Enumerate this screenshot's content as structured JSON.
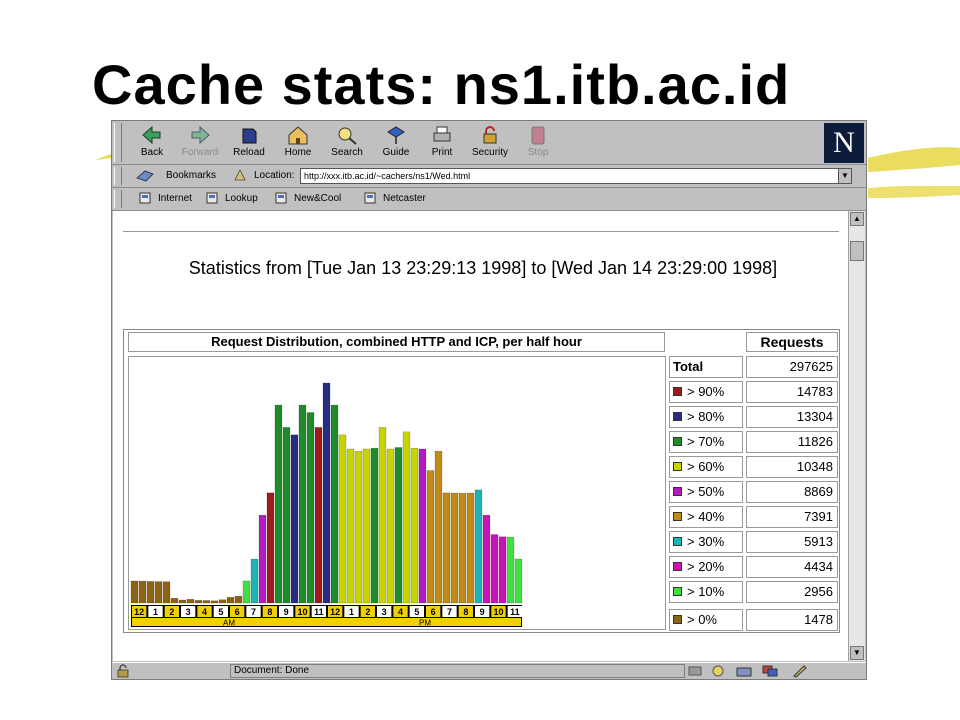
{
  "slide": {
    "title": "Cache stats: ns1.itb.ac.id"
  },
  "browser": {
    "nav_buttons": [
      {
        "label": "Back",
        "icon": "back-arrow-icon",
        "disabled": false
      },
      {
        "label": "Forward",
        "icon": "forward-arrow-icon",
        "disabled": true
      },
      {
        "label": "Reload",
        "icon": "reload-icon",
        "disabled": false
      },
      {
        "label": "Home",
        "icon": "home-icon",
        "disabled": false
      },
      {
        "label": "Search",
        "icon": "search-icon",
        "disabled": false
      },
      {
        "label": "Guide",
        "icon": "guide-icon",
        "disabled": false
      },
      {
        "label": "Print",
        "icon": "print-icon",
        "disabled": false
      },
      {
        "label": "Security",
        "icon": "lock-icon",
        "disabled": false
      },
      {
        "label": "Stop",
        "icon": "stop-icon",
        "disabled": true
      }
    ],
    "bookmarks_label": "Bookmarks",
    "location_label": "Location:",
    "url": "http://xxx.itb.ac.id/~cachers/ns1/Wed.html",
    "personal": [
      "Internet",
      "Lookup",
      "New&Cool",
      "Netcaster"
    ],
    "status": "Document: Done"
  },
  "page": {
    "heading": "Statistics from [Tue Jan 13 23:29:13 1998] to [Wed Jan 14 23:29:00 1998]",
    "chart_title": "Request Distribution, combined HTTP and ICP, per half hour",
    "requests_header": "Requests",
    "total_label": "Total",
    "total_value": "297625",
    "legend": [
      {
        "label": "> 90%",
        "value": "14783",
        "color": "#9c1c1c"
      },
      {
        "label": "> 80%",
        "value": "13304",
        "color": "#282c84"
      },
      {
        "label": "> 70%",
        "value": "11826",
        "color": "#1e8c28"
      },
      {
        "label": "> 60%",
        "value": "10348",
        "color": "#c8d400"
      },
      {
        "label": "> 50%",
        "value": "8869",
        "color": "#b01cc0"
      },
      {
        "label": "> 40%",
        "value": "7391",
        "color": "#c08c14"
      },
      {
        "label": "> 30%",
        "value": "5913",
        "color": "#1cb4b4"
      },
      {
        "label": "> 20%",
        "value": "4434",
        "color": "#c814b4"
      },
      {
        "label": "> 10%",
        "value": "2956",
        "color": "#40e040"
      },
      {
        "label": "> 0%",
        "value": "1478",
        "color": "#8c6414"
      }
    ]
  },
  "chart_data": {
    "type": "bar",
    "title": "Request Distribution, combined HTTP and ICP, per half hour",
    "hour_labels": [
      "12",
      "1",
      "2",
      "3",
      "4",
      "5",
      "6",
      "7",
      "8",
      "9",
      "10",
      "11",
      "12",
      "1",
      "2",
      "3",
      "4",
      "5",
      "6",
      "7",
      "8",
      "9",
      "10",
      "11"
    ],
    "period_labels": [
      "AM",
      "PM"
    ],
    "max_value": 14783,
    "values": [
      1480,
      1470,
      1450,
      1440,
      1430,
      320,
      200,
      250,
      180,
      170,
      150,
      220,
      380,
      460,
      1480,
      2950,
      5900,
      7400,
      13300,
      11800,
      11300,
      13300,
      12800,
      11800,
      14783,
      13300,
      11300,
      10350,
      10200,
      10350,
      10400,
      11800,
      10350,
      10450,
      11500,
      10400,
      10350,
      8900,
      10200,
      7400,
      7390,
      7380,
      7391,
      7600,
      5900,
      4600,
      4450,
      4430,
      2956
    ],
    "colors": [
      "#8c6414",
      "#8c6414",
      "#8c6414",
      "#8c6414",
      "#8c6414",
      "#8c6414",
      "#8c6414",
      "#8c6414",
      "#8c6414",
      "#8c6414",
      "#8c6414",
      "#8c6414",
      "#8c6414",
      "#8c6414",
      "#40e040",
      "#1cb4b4",
      "#b01cc0",
      "#9c1c1c",
      "#1e8c28",
      "#1e8c28",
      "#282c84",
      "#1e8c28",
      "#1e8c28",
      "#9c1c1c",
      "#282c84",
      "#1e8c28",
      "#c8d400",
      "#c8d400",
      "#c8d400",
      "#c8d400",
      "#1e8c28",
      "#c8d400",
      "#c8d400",
      "#1e8c28",
      "#c8d400",
      "#c8d400",
      "#b01cc0",
      "#c08c14",
      "#c08c14",
      "#c08c14",
      "#c08c14",
      "#c08c14",
      "#c08c14",
      "#1cb4b4",
      "#c814b4",
      "#c814b4",
      "#c814b4",
      "#40e040",
      "#40e040"
    ]
  }
}
